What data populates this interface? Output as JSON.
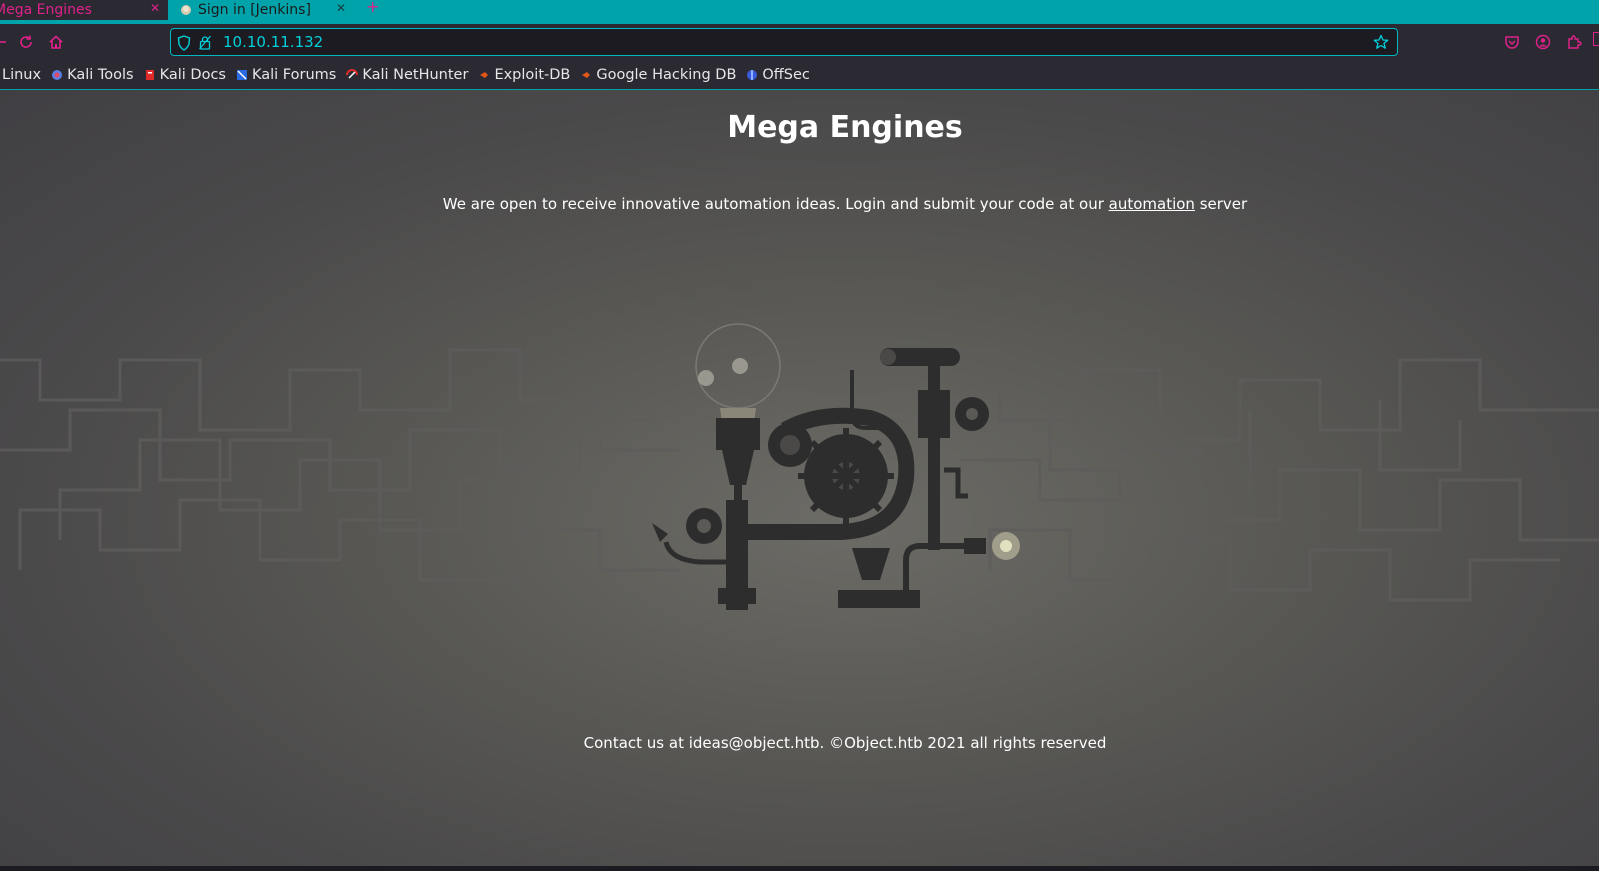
{
  "browser": {
    "tabs": [
      {
        "title": "Mega Engines",
        "active": true
      },
      {
        "title": "Sign in [Jenkins]",
        "active": false
      }
    ],
    "new_tab_symbol": "+",
    "url": "10.10.11.132",
    "accent_color": "#00a3aa",
    "highlight_color": "#e0218a"
  },
  "bookmarks": [
    {
      "label": "Linux",
      "icon": "kali-icon"
    },
    {
      "label": "Kali Tools",
      "icon": "kali-tools-icon"
    },
    {
      "label": "Kali Docs",
      "icon": "kali-docs-icon"
    },
    {
      "label": "Kali Forums",
      "icon": "kali-forums-icon"
    },
    {
      "label": "Kali NetHunter",
      "icon": "nethunter-icon"
    },
    {
      "label": "Exploit-DB",
      "icon": "exploitdb-icon"
    },
    {
      "label": "Google Hacking DB",
      "icon": "ghdb-icon"
    },
    {
      "label": "OffSec",
      "icon": "offsec-icon"
    }
  ],
  "page": {
    "title": "Mega Engines",
    "tagline_before": "We are open to receive innovative automation ideas. Login and submit your code at our ",
    "tagline_link": "automation",
    "tagline_after": " server",
    "footer": "Contact us at ideas@object.htb. ©Object.htb 2021 all rights reserved"
  }
}
